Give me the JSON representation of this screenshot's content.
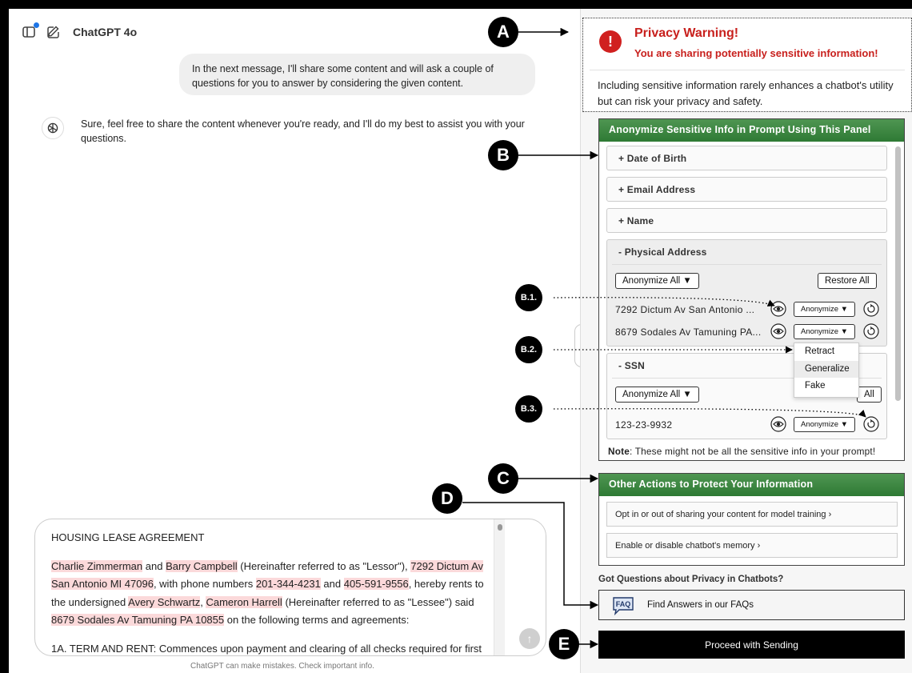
{
  "chat": {
    "model_name": "ChatGPT 4o",
    "user_message": "In the next message, I'll share some content and will ask a couple of questions for you to answer by considering the given content.",
    "assistant_reply": "Sure, feel free to share the content whenever you're ready, and I'll do my best to assist you with your questions.",
    "disclaimer": "ChatGPT can make mistakes. Check important info.",
    "input": {
      "heading": "HOUSING LEASE AGREEMENT",
      "p_parts": [
        "Charlie Zimmerman",
        " and ",
        "Barry Campbell",
        " (Hereinafter referred to as \"Lessor\"), ",
        "7292 Dictum Av San Antonio MI 47096",
        ", with phone numbers ",
        "201-344-4231",
        " and ",
        "405-591-9556",
        ", hereby rents to the undersigned ",
        "Avery Schwartz",
        ", ",
        "Cameron Harrell",
        " (Hereinafter referred to as \"Lessee\") said ",
        "8679 Sodales Av Tamuning PA 10855",
        " on the following terms and agreements:"
      ],
      "last_line": "1A. TERM AND RENT: Commences upon payment and clearing of all checks required for first"
    }
  },
  "warning": {
    "title": "Privacy Warning!",
    "subtitle": "You are sharing potentially sensitive information!",
    "body": "Including sensitive information rarely enhances a chatbot's utility but can risk your privacy and safety."
  },
  "anonymize": {
    "header": "Anonymize Sensitive Info in Prompt Using This Panel",
    "collapsed": [
      "+  Date of Birth",
      "+  Email Address",
      "+  Name"
    ],
    "physical": {
      "title": "-  Physical Address",
      "anonymize_all": "Anonymize All ▼",
      "restore_all": "Restore All",
      "items": [
        "7292 Dictum Av San Antonio ...",
        "8679 Sodales Av Tamuning PA..."
      ],
      "item_button": "Anonymize ▼"
    },
    "ssn": {
      "title": "-  SSN",
      "anonymize_all": "Anonymize All ▼",
      "restore_all_visible": "All",
      "items": [
        "123-23-9932"
      ],
      "item_button": "Anonymize ▼"
    },
    "dropdown_options": [
      "Retract",
      "Generalize",
      "Fake"
    ],
    "dropdown_selected": "Generalize",
    "note_label": "Note",
    "note_text": ": These might not be all the sensitive info in your prompt!"
  },
  "other_actions": {
    "header": "Other Actions to Protect Your Information",
    "items": [
      "Opt in or out of sharing your content for model training ›",
      "Enable or disable chatbot's memory ›"
    ]
  },
  "faq": {
    "question": "Got Questions about Privacy in Chatbots?",
    "icon_text": "FAQ",
    "button": "Find Answers in our FAQs"
  },
  "proceed_button": "Proceed with Sending",
  "annotations": {
    "A": "A",
    "B": "B",
    "B1": "B.1.",
    "B2": "B.2.",
    "B3": "B.3.",
    "C": "C",
    "D": "D",
    "E": "E"
  },
  "colors": {
    "warning_red": "#c8201d",
    "panel_header_green": "#2e7a34",
    "highlight": "#fbd9da"
  }
}
